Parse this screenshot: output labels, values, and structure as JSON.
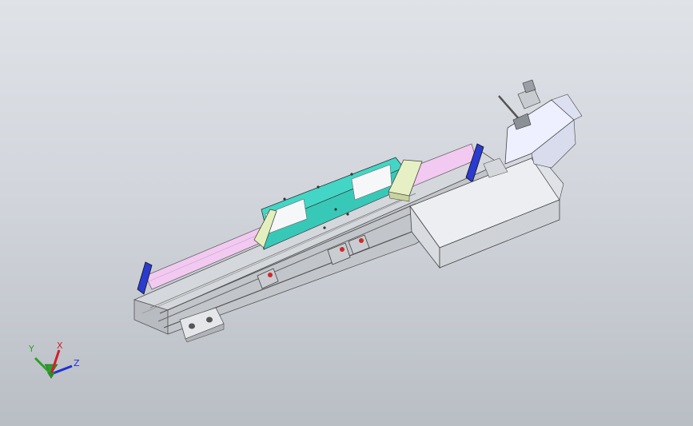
{
  "triad": {
    "x_label": "X",
    "y_label": "Y",
    "z_label": "Z",
    "x_color": "#d0202a",
    "y_color": "#2aa02a",
    "z_color": "#2030d0"
  },
  "colors": {
    "rail_body": "#c9ccd0",
    "belt": "#f0c8f0",
    "carriage": "#3ecfc0",
    "carriage_pads": "#f4f6f8",
    "end_caps": "#2838c8",
    "bracket": "#e8f0c0",
    "motor_housing": "#e2e5ea",
    "motor_can": "#eef0ff",
    "stopper_accent": "#d02828"
  }
}
